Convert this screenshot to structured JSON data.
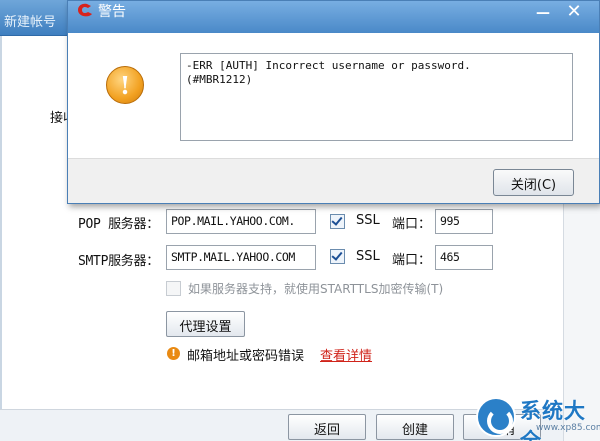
{
  "background_dialog": {
    "title": "新建帐号",
    "side_label": "接收",
    "pop": {
      "label": "POP 服务器：",
      "server": "POP.MAIL.YAHOO.COM.",
      "ssl_checked": true,
      "ssl_label": "SSL",
      "port_label": "端口：",
      "port": "995"
    },
    "smtp": {
      "label": "SMTP服务器：",
      "server": "SMTP.MAIL.YAHOO.COM",
      "ssl_checked": true,
      "ssl_label": "SSL",
      "port_label": "端口：",
      "port": "465"
    },
    "starttls_label": "如果服务器支持，就使用STARTTLS加密传输(T)",
    "proxy_button": "代理设置",
    "error_message": "邮箱地址或密码错误",
    "error_link": "查看详情",
    "buttons": {
      "back": "返回",
      "create": "创建",
      "cancel": "取消"
    }
  },
  "alert": {
    "title": "警告",
    "message": "-ERR [AUTH] Incorrect username or password.\n(#MBR1212)",
    "close_button": "关闭(C)",
    "minimize_symbol": "—",
    "close_symbol": "✕"
  },
  "watermark": {
    "text": "系统大全",
    "sub": "www.xp85.com"
  },
  "colors": {
    "titlebar": "#4a89c8",
    "link_red": "#d0241b",
    "warning_orange": "#f2a121"
  },
  "icons": [
    "app-logo-icon",
    "warning-exclamation-icon",
    "error-dot-icon",
    "checkbox-checked-icon"
  ]
}
